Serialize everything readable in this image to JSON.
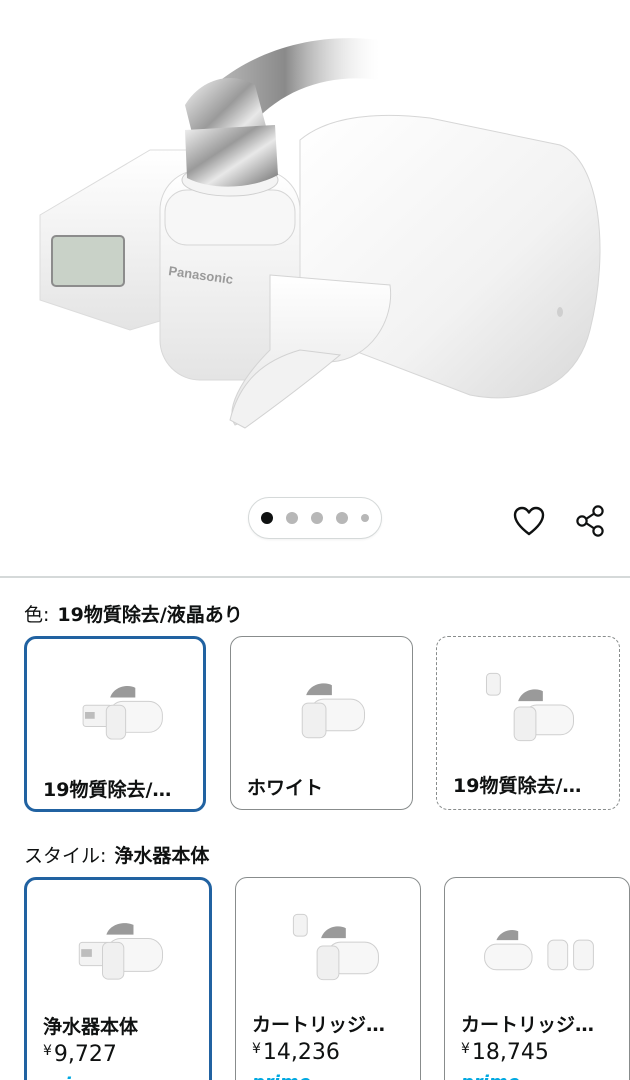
{
  "product": {
    "brand_on_device": "Panasonic"
  },
  "carousel": {
    "dots": [
      {
        "active": true
      },
      {
        "active": false
      },
      {
        "active": false
      },
      {
        "active": false
      },
      {
        "active": false,
        "small": true
      }
    ]
  },
  "actions": {
    "wishlist_icon": "heart-icon",
    "share_icon": "share-icon"
  },
  "color_selector": {
    "label": "色:",
    "value": "19物質除去/液晶あり",
    "options": [
      {
        "title": "19物質除去/…",
        "selected": true
      },
      {
        "title": "ホワイト",
        "selected": false
      },
      {
        "title": "19物質除去/…",
        "selected": false,
        "dashed": true
      }
    ]
  },
  "style_selector": {
    "label": "スタイル:",
    "value": "浄水器本体",
    "options": [
      {
        "title": "浄水器本体",
        "yen": "¥",
        "price": "9,727",
        "prime": "prime",
        "selected": true
      },
      {
        "title": "カートリッジ…",
        "yen": "¥",
        "price": "14,236",
        "prime": "prime",
        "selected": false
      },
      {
        "title": "カートリッジ…",
        "yen": "¥",
        "price": "18,745",
        "prime": "prime",
        "selected": false
      }
    ]
  },
  "colors": {
    "selected_border": "#2162a1",
    "prime_blue": "#00a8e1",
    "text": "#0f1111"
  }
}
